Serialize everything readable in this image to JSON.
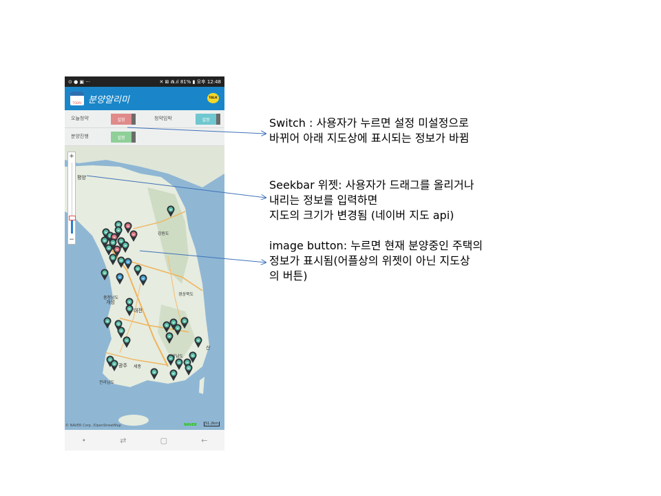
{
  "status_bar": {
    "left_icons": "⊙ ● ▣ ···",
    "right_text": "✕ ⊠ ⋒.ıl 81% ▮ 오후 12:48"
  },
  "app_bar": {
    "logo_text": "TODAY",
    "title": "분양알리미",
    "talk_label": "TALK"
  },
  "switches": {
    "today_label": "오늘청약",
    "today_state": "설정",
    "imminent_label": "청약임박",
    "imminent_state": "설정",
    "ongoing_label": "분양진행",
    "ongoing_state": "설정"
  },
  "map": {
    "zoom_in": "+",
    "zoom_out": "−",
    "zoom_level_fraction": 0.21,
    "credit": "© NAVER Corp. /OpenStreetMap",
    "scale": "51.2km",
    "naver_logo": "NAVER",
    "place_labels": [
      "평양",
      "개성",
      "강원도",
      "경상북도",
      "세종",
      "충청남도",
      "대전",
      "경상남도",
      "전라남도",
      "광주",
      "산"
    ]
  },
  "colors": {
    "app_bar": "#1a86c9",
    "switch_on_red": "#e08a8a",
    "switch_on_teal": "#6fc7cf",
    "switch_on_green": "#8fcf98",
    "marker_teal": "#5bbfa7",
    "marker_red": "#d9737d",
    "marker_blue": "#4aa3d6",
    "arrow": "#3e6fb8"
  },
  "annotations": {
    "switch": [
      "Switch : 사용자가 누르면 설정 미설정으로",
      "바뀌어 아래 지도상에 표시되는 정보가 바뀜"
    ],
    "seekbar": [
      "Seekbar 위젯: 사용자가 드래그를 올리거나",
      "내리는 정보를 입력하면",
      "지도의 크기가 변경됨 (네이버 지도 api)"
    ],
    "image_button": [
      "image button: 누르면 현재 분양중인 주택의",
      "정보가 표시됨(어플상의 위젯이 아닌 지도상",
      "의 버튼)"
    ]
  }
}
